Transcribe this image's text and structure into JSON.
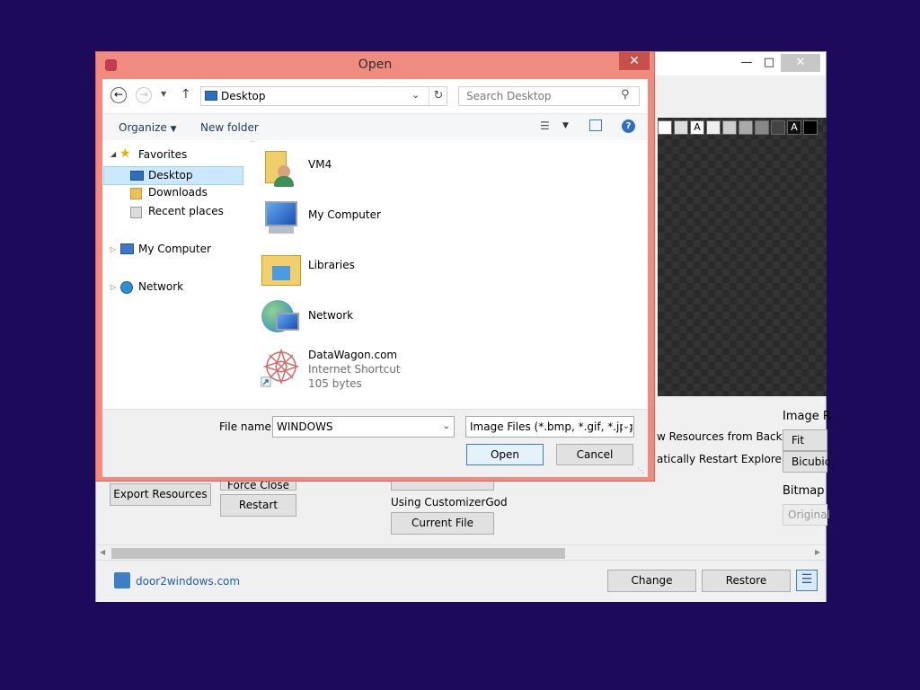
{
  "app": {
    "minimize_icon": "minimize-icon",
    "maximize_icon": "maximize-icon",
    "close_label": "✕",
    "partial_labels": {
      "show_resources": "w Resources from Backup",
      "auto_restart": "atically Restart Explorer",
      "image_resize": "Image R",
      "fit_resize": "Fit Resiz",
      "bicubic": "Bicubic",
      "bitmap": "Bitmap",
      "original": "Original"
    },
    "export_button": "Export Resources",
    "force_close_button": "Force Close",
    "restart_button": "Restart",
    "using_label": "Using CustomizerGod",
    "current_file_button": "Current File",
    "site_link": "door2windows.com",
    "change_button": "Change",
    "restore_button": "Restore",
    "swatch_label": "A"
  },
  "dialog": {
    "title": "Open",
    "close_label": "✕",
    "address": "Desktop",
    "search_placeholder": "Search Desktop",
    "organize": "Organize",
    "new_folder": "New folder",
    "tree": {
      "favorites": "Favorites",
      "desktop": "Desktop",
      "downloads": "Downloads",
      "recent": "Recent places",
      "my_computer": "My Computer",
      "network": "Network"
    },
    "files": [
      {
        "name": "VM4"
      },
      {
        "name": "My Computer"
      },
      {
        "name": "Libraries"
      },
      {
        "name": "Network"
      },
      {
        "name": "DataWagon.com",
        "type": "Internet Shortcut",
        "size": "105 bytes"
      }
    ],
    "file_name_label": "File name:",
    "file_name_value": "WINDOWS",
    "file_type": "Image Files (*.bmp, *.gif, *.jpg,",
    "open_button": "Open",
    "cancel_button": "Cancel"
  },
  "colors": {
    "desktop_bg": "#1e0a5a",
    "dialog_frame": "#f08c7f",
    "dialog_close": "#c7504a",
    "selection": "#cce8ff"
  }
}
